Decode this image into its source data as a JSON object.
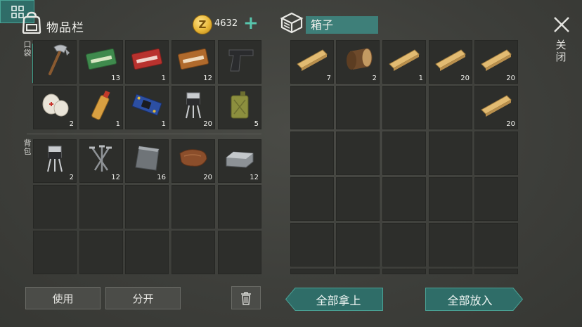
{
  "inventory": {
    "title": "物品栏",
    "coins": "4632",
    "coin_symbol": "Z"
  },
  "container": {
    "title": "箱子",
    "close_label": "关闭"
  },
  "labels": {
    "pocket": "口袋",
    "backpack": "背包"
  },
  "pocket_slots": [
    {
      "item": "hatchet-icon",
      "count": ""
    },
    {
      "item": "ration-coupon-icon",
      "count": "13"
    },
    {
      "item": "combat-gear-coupon-icon",
      "count": "1"
    },
    {
      "item": "upgrade-coupon-icon",
      "count": "12"
    },
    {
      "item": "pistol-icon",
      "count": ""
    },
    {
      "item": "bandage-icon",
      "count": "2"
    },
    {
      "item": "gasoline-bottle-icon",
      "count": "1"
    },
    {
      "item": "circuit-board-icon",
      "count": "1"
    },
    {
      "item": "transistor-icon",
      "count": "20"
    },
    {
      "item": "jerrycan-icon",
      "count": "5"
    }
  ],
  "backpack_slots": [
    {
      "item": "transistor-icon",
      "count": "2"
    },
    {
      "item": "nails-icon",
      "count": "12"
    },
    {
      "item": "metal-plate-icon",
      "count": "16"
    },
    {
      "item": "leather-icon",
      "count": "20"
    },
    {
      "item": "iron-ingot-icon",
      "count": "12"
    },
    {
      "item": "",
      "count": ""
    },
    {
      "item": "",
      "count": ""
    },
    {
      "item": "",
      "count": ""
    },
    {
      "item": "",
      "count": ""
    },
    {
      "item": "",
      "count": ""
    },
    {
      "item": "",
      "count": ""
    },
    {
      "item": "",
      "count": ""
    },
    {
      "item": "",
      "count": ""
    },
    {
      "item": "",
      "count": ""
    },
    {
      "item": "",
      "count": ""
    }
  ],
  "box_slots": [
    {
      "item": "wood-plank-icon",
      "count": "7"
    },
    {
      "item": "log-icon",
      "count": "2"
    },
    {
      "item": "wood-plank-icon",
      "count": "1"
    },
    {
      "item": "wood-plank-icon",
      "count": "20"
    },
    {
      "item": "wood-plank-icon",
      "count": "20"
    },
    {
      "item": "",
      "count": ""
    },
    {
      "item": "",
      "count": ""
    },
    {
      "item": "",
      "count": ""
    },
    {
      "item": "",
      "count": ""
    },
    {
      "item": "wood-plank-icon",
      "count": "20"
    }
  ],
  "buttons": {
    "use": "使用",
    "split": "分开",
    "take_all": "全部拿上",
    "put_all": "全部放入"
  },
  "colors": {
    "accent": "#3e7f79",
    "plus": "#58c6ad",
    "slot": "#2d2e2b"
  }
}
